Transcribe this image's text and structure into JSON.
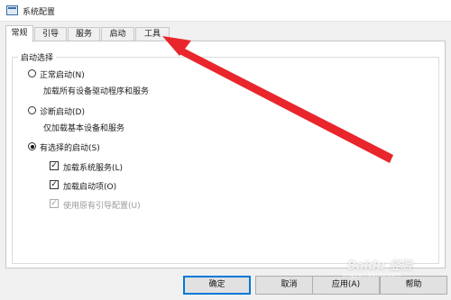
{
  "window": {
    "title": "系统配置"
  },
  "tabs": [
    {
      "label": "常规",
      "active": true
    },
    {
      "label": "引导",
      "active": false
    },
    {
      "label": "服务",
      "active": false
    },
    {
      "label": "启动",
      "active": false
    },
    {
      "label": "工具",
      "active": false
    }
  ],
  "startup_group": {
    "legend": "启动选择",
    "options": [
      {
        "label": "正常启动(N)",
        "description": "加载所有设备驱动程序和服务",
        "selected": false
      },
      {
        "label": "诊断启动(D)",
        "description": "仅加载基本设备和服务",
        "selected": false
      },
      {
        "label": "有选择的启动(S)",
        "selected": true
      }
    ],
    "selective_items": [
      {
        "label": "加载系统服务(L)",
        "checked": true,
        "enabled": true
      },
      {
        "label": "加载启动项(O)",
        "checked": true,
        "enabled": true
      },
      {
        "label": "使用原有引导配置(U)",
        "checked": true,
        "enabled": false
      }
    ]
  },
  "buttons": {
    "ok": "确定",
    "cancel": "取消",
    "apply": "应用(A)",
    "help": "帮助"
  },
  "annotation": {
    "arrow_color": "#e8262b",
    "points_to": "tab-tools"
  },
  "watermark": {
    "text": "Baidu 经验",
    "sub": "jingyan.baidu.com"
  }
}
